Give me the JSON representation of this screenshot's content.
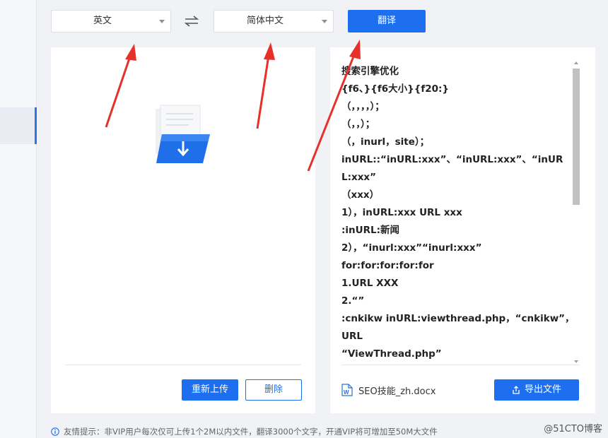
{
  "languages": {
    "source": "英文",
    "target": "简体中文"
  },
  "toolbar": {
    "translate_label": "翻译"
  },
  "left_panel": {
    "reupload_label": "重新上传",
    "delete_label": "删除"
  },
  "right_panel": {
    "lines": [
      "搜索引擎优化",
      "{f6、}{f6大小}{f20:}",
      "（，，，，）；",
      "（，，）；",
      "（，inurl，site）；",
      "inURL::“inURL:xxx”、“inURL:xxx”、“inUR",
      "L:xxx”",
      "（xxx）",
      "1），inURL:xxx URL xxx",
      ":inURL:新闻",
      "2），“inurl:xxx”“inurl:xxx”",
      "for:for:for:for:for",
      "1.URL XXX",
      "2.“”",
      ":cnkikw inURL:viewthread.php，“cnkikw”，",
      "URL",
      "“ViewThread.php”"
    ],
    "file_name": "SEO技能_zh.docx",
    "export_label": "导出文件"
  },
  "tip": "友情提示：非VIP用户每次仅可上传1个2M以内文件，翻译3000个文字，开通VIP将可增加至50M大文件",
  "watermark": "@51CTO博客",
  "colors": {
    "primary": "#1e6ff0",
    "arrow": "#e8302a"
  },
  "icons": [
    "swap-icon",
    "file-download-icon",
    "word-doc-icon",
    "export-icon",
    "info-icon",
    "chevron-down-icon"
  ]
}
